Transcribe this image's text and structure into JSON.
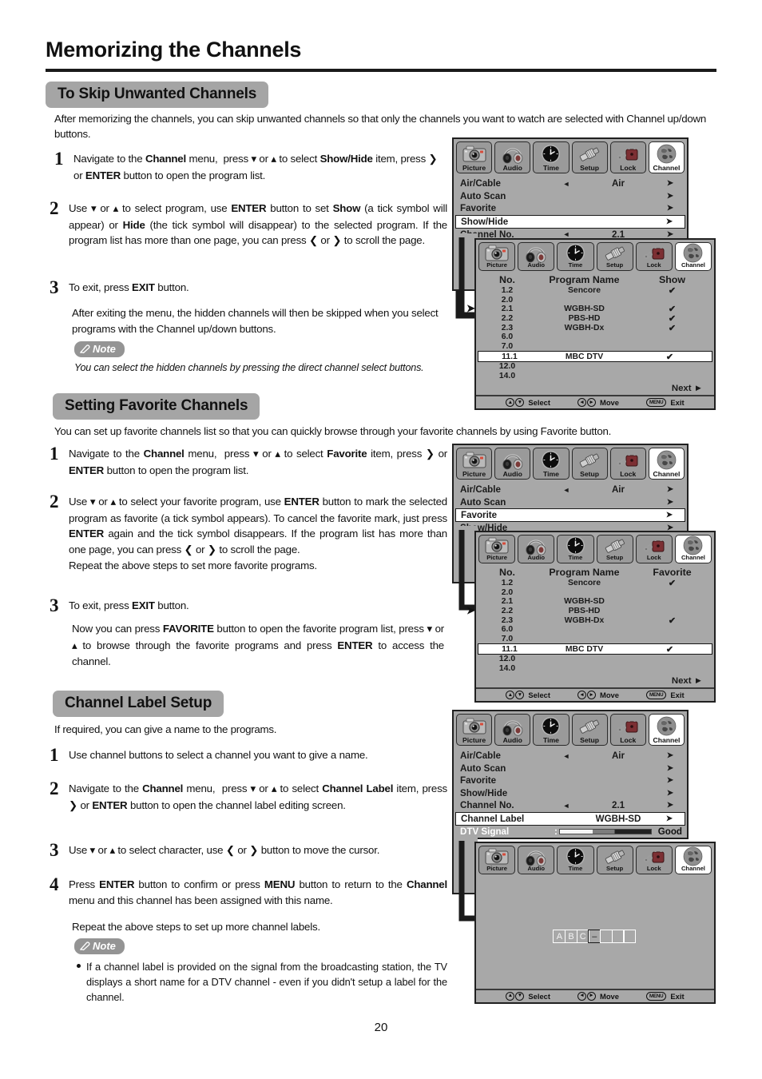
{
  "document": {
    "title": "Memorizing the Channels",
    "page_number": "20"
  },
  "sections": [
    {
      "id": "skip",
      "heading": "To Skip Unwanted Channels",
      "intro": "After memorizing the channels, you can skip unwanted channels so that only the channels you want to watch are selected with Channel up/down buttons.",
      "steps": [
        {
          "num": "1",
          "text_html": "Navigate to the <b>Channel</b> menu,&nbsp; press <span class=\"arrow-ch\">▾</span> or <span class=\"arrow-ch\">▴</span> to select <b>Show/Hide</b> item, press <span class=\"arrow-ch\">❯</span> or <b>ENTER</b> button to open the program list."
        },
        {
          "num": "2",
          "text_html": "Use <span class=\"arrow-ch\">▾</span> or <span class=\"arrow-ch\">▴</span> to select program, use <b>ENTER</b> button to set <b>Show</b> (a tick symbol will appear) or <b>Hide</b> (the tick symbol will disappear) to the selected program. If the program list has more than one page, you can press <span class=\"arrow-ch\">❮</span> or <span class=\"arrow-ch\">❯</span> to scroll the page."
        },
        {
          "num": "3",
          "text_html": "To exit, press <b>EXIT</b> button."
        }
      ],
      "after_text": "After exiting the menu, the hidden channels will then be skipped when you select programs with the Channel up/down buttons.",
      "note_label": "Note",
      "note_text": "You can select the hidden channels by pressing the direct channel select buttons."
    },
    {
      "id": "favorite",
      "heading": "Setting Favorite Channels",
      "intro": "You can set up favorite channels list so that you can quickly browse through your favorite channels by using Favorite button.",
      "steps": [
        {
          "num": "1",
          "text_html": "Navigate to the <b>Channel</b> menu,&nbsp; press <span class=\"arrow-ch\">▾</span> or <span class=\"arrow-ch\">▴</span> to select <b>Favorite</b> item, press <span class=\"arrow-ch\">❯</span> or <b>ENTER</b> button to open the program list."
        },
        {
          "num": "2",
          "text_html": "Use <span class=\"arrow-ch\">▾</span> or <span class=\"arrow-ch\">▴</span> to select your favorite program, use <b>ENTER</b> button to mark the selected program as favorite (a tick symbol appears). To cancel the favorite mark, just press <b>ENTER</b> again and the tick symbol disappears. If the program list has more than one page, you can press <span class=\"arrow-ch\">❮</span> or <span class=\"arrow-ch\">❯</span> to scroll the page.<br>Repeat the above steps to set more favorite programs."
        },
        {
          "num": "3",
          "text_html": "To exit, press <b>EXIT</b> button."
        }
      ],
      "after_text_html": "Now you can press <b>FAVORITE</b> button to open the favorite program list, press <span class=\"arrow-ch\">▾</span> or <span class=\"arrow-ch\">▴</span> to browse through the favorite programs and press <b>ENTER</b> to access the channel."
    },
    {
      "id": "label",
      "heading": "Channel Label Setup",
      "intro": "If required, you can give a name to the programs.",
      "steps": [
        {
          "num": "1",
          "text_html": "Use channel buttons to select a channel you want to give a name."
        },
        {
          "num": "2",
          "text_html": "Navigate to the <b>Channel</b> menu,&nbsp; press <span class=\"arrow-ch\">▾</span> or <span class=\"arrow-ch\">▴</span> to select <b>Channel Label</b> item, press <span class=\"arrow-ch\">❯</span> or <b>ENTER</b> button to open the channel label editing screen."
        },
        {
          "num": "3",
          "text_html": "Use <span class=\"arrow-ch\">▾</span> or <span class=\"arrow-ch\">▴</span> to select character, use <span class=\"arrow-ch\">❮</span> or <span class=\"arrow-ch\">❯</span> button to move the cursor."
        },
        {
          "num": "4",
          "text_html": "Press <b>ENTER</b> button to confirm or press <b>MENU</b> button to return to the <b>Channel</b> menu and this channel has been assigned with this name."
        }
      ],
      "after_text": "Repeat the above steps to set up more channel labels.",
      "note_label": "Note",
      "note_bullet": "If a channel label is provided on the signal from the broadcasting station,  the TV displays a short name for a DTV channel - even if you didn't setup a label for the channel."
    }
  ],
  "osd": {
    "icon_tabs": [
      {
        "name": "Picture",
        "icon": "camera-icon"
      },
      {
        "name": "Audio",
        "icon": "headphones-icon"
      },
      {
        "name": "Time",
        "icon": "clock-icon"
      },
      {
        "name": "Setup",
        "icon": "connector-icon"
      },
      {
        "name": "Lock",
        "icon": "padlock-icon"
      },
      {
        "name": "Channel",
        "icon": "globe-icon"
      }
    ],
    "active_tab": "Channel",
    "hints": [
      {
        "keys": [
          "▲",
          "▼"
        ],
        "label": "Select"
      },
      {
        "keys": [
          "◄",
          "►"
        ],
        "label": "Move"
      },
      {
        "keys": [
          "MENU"
        ],
        "label": "Exit"
      }
    ],
    "next_label": "Next",
    "channel_menu": {
      "rows": [
        {
          "label": "Air/Cable",
          "left_arrow": true,
          "value": "Air",
          "right_arrow": true
        },
        {
          "label": "Auto Scan",
          "left_arrow": false,
          "value": "",
          "right_arrow": true
        },
        {
          "label": "Favorite",
          "left_arrow": false,
          "value": "",
          "right_arrow": true
        },
        {
          "label": "Show/Hide",
          "left_arrow": false,
          "value": "",
          "right_arrow": true
        },
        {
          "label": "Channel No.",
          "left_arrow": true,
          "value": "2.1",
          "right_arrow": true
        },
        {
          "label": "Channel Label",
          "left_arrow": false,
          "value": "WGBH-SD",
          "right_arrow": true
        }
      ],
      "signal_row": {
        "label": "DTV Signal",
        "colon": ":",
        "quality": "Good"
      }
    },
    "program_list": {
      "columns_show": [
        "No.",
        "Program Name",
        "Show"
      ],
      "columns_favorite": [
        "No.",
        "Program Name",
        "Favorite"
      ],
      "rows_show": [
        {
          "no": "1.2",
          "name": "Sencore",
          "flag": "✔",
          "selected": false,
          "pointer": false
        },
        {
          "no": "2.0",
          "name": "",
          "flag": "",
          "selected": false,
          "pointer": false
        },
        {
          "no": "2.1",
          "name": "WGBH-SD",
          "flag": "✔",
          "selected": false,
          "pointer": true
        },
        {
          "no": "2.2",
          "name": "PBS-HD",
          "flag": "✔",
          "selected": false,
          "pointer": false
        },
        {
          "no": "2.3",
          "name": "WGBH-Dx",
          "flag": "✔",
          "selected": false,
          "pointer": false
        },
        {
          "no": "6.0",
          "name": "",
          "flag": "",
          "selected": false,
          "pointer": false
        },
        {
          "no": "7.0",
          "name": "",
          "flag": "",
          "selected": false,
          "pointer": false
        },
        {
          "no": "11.1",
          "name": "MBC DTV",
          "flag": "✔",
          "selected": true,
          "pointer": false
        },
        {
          "no": "12.0",
          "name": "",
          "flag": "",
          "selected": false,
          "pointer": false
        },
        {
          "no": "14.0",
          "name": "",
          "flag": "",
          "selected": false,
          "pointer": false
        }
      ],
      "rows_favorite": [
        {
          "no": "1.2",
          "name": "Sencore",
          "flag": "✔",
          "selected": false,
          "pointer": false
        },
        {
          "no": "2.0",
          "name": "",
          "flag": "",
          "selected": false,
          "pointer": false
        },
        {
          "no": "2.1",
          "name": "WGBH-SD",
          "flag": "",
          "selected": false,
          "pointer": false
        },
        {
          "no": "2.2",
          "name": "PBS-HD",
          "flag": "",
          "selected": false,
          "pointer": true
        },
        {
          "no": "2.3",
          "name": "WGBH-Dx",
          "flag": "✔",
          "selected": false,
          "pointer": false
        },
        {
          "no": "6.0",
          "name": "",
          "flag": "",
          "selected": false,
          "pointer": false
        },
        {
          "no": "7.0",
          "name": "",
          "flag": "",
          "selected": false,
          "pointer": false
        },
        {
          "no": "11.1",
          "name": "MBC DTV",
          "flag": "✔",
          "selected": true,
          "pointer": false
        },
        {
          "no": "12.0",
          "name": "",
          "flag": "",
          "selected": false,
          "pointer": false
        },
        {
          "no": "14.0",
          "name": "",
          "flag": "",
          "selected": false,
          "pointer": false
        }
      ]
    },
    "label_editor": {
      "chars": [
        "A",
        "B",
        "C",
        "–",
        "",
        "",
        ""
      ],
      "cursor_index": 3
    }
  },
  "colors": {
    "osd_background": "#a8a8a8",
    "osd_border": "#202020",
    "heading_pill": "#a5a5a5",
    "note_pill": "#949494",
    "selected_row": "#ffffff",
    "text": "#1a1a1a"
  }
}
